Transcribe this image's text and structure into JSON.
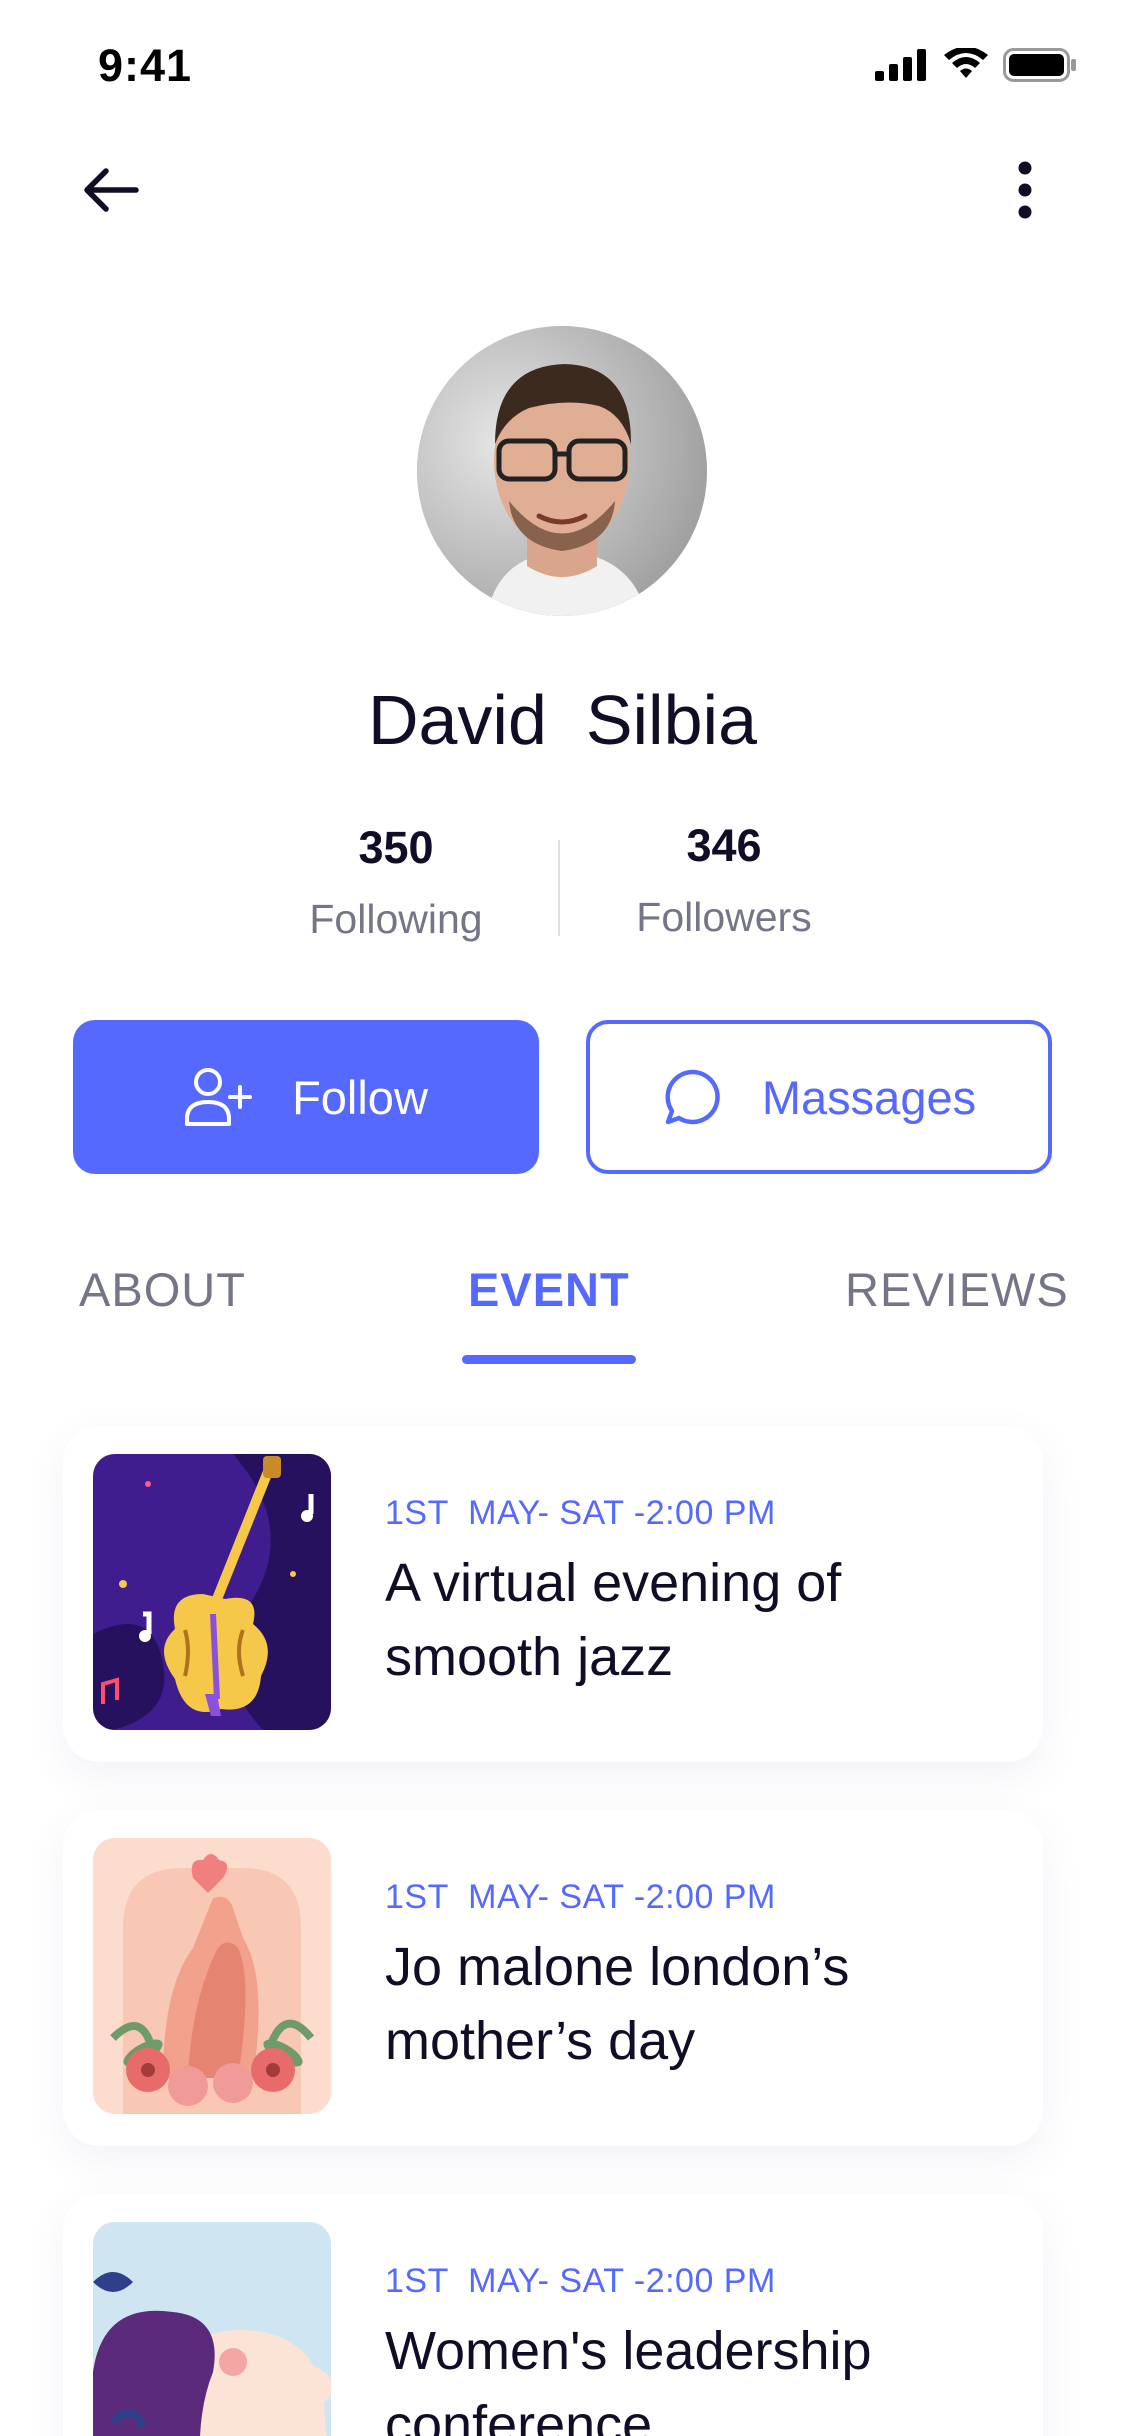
{
  "status_bar": {
    "time": "9:41"
  },
  "header": {
    "back_icon": "arrow-left-icon",
    "more_icon": "more-vertical-icon"
  },
  "profile": {
    "name": "David  Silbia",
    "following_count": "350",
    "following_label": "Following",
    "followers_count": "346",
    "followers_label": "Followers"
  },
  "actions": {
    "follow_label": "Follow",
    "follow_icon": "user-plus-icon",
    "messages_label": "Massages",
    "messages_icon": "chat-bubble-icon"
  },
  "tabs": [
    {
      "label": "ABOUT",
      "active": false
    },
    {
      "label": "EVENT",
      "active": true
    },
    {
      "label": "REVIEWS",
      "active": false
    }
  ],
  "events": [
    {
      "date": "1ST  MAY- SAT -2:00 PM",
      "title": "A virtual evening of smooth jazz"
    },
    {
      "date": "1ST  MAY- SAT -2:00 PM",
      "title": "Jo malone london’s mother’s day"
    },
    {
      "date": "1ST  MAY- SAT -2:00 PM",
      "title": "Women's leadership conference"
    }
  ],
  "colors": {
    "accent": "#5669FF",
    "text_primary": "#120D26",
    "text_secondary": "#747688"
  }
}
